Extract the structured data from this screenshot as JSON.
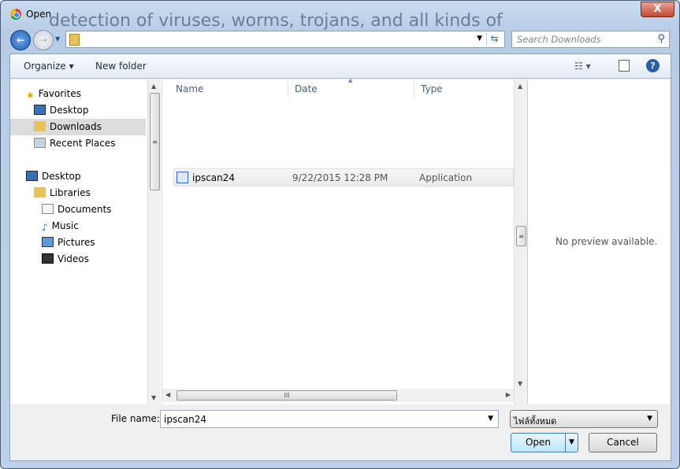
{
  "background": {
    "text": "detection of viruses, worms, trojans, and all kinds of"
  },
  "window": {
    "title": "Open",
    "close_label": "X"
  },
  "address": {
    "path": "",
    "search_placeholder": "Search Downloads"
  },
  "toolbar": {
    "organize": "Organize ▾",
    "new_folder": "New folder"
  },
  "nav": {
    "favorites": "Favorites",
    "favorites_items": [
      "Desktop",
      "Downloads",
      "Recent Places"
    ],
    "desktop": "Desktop",
    "libraries": "Libraries",
    "library_items": [
      "Documents",
      "Music",
      "Pictures",
      "Videos"
    ],
    "selected": "Downloads"
  },
  "list": {
    "columns": [
      "Name",
      "Date",
      "Type"
    ],
    "files": [
      {
        "name": "ipscan24",
        "date": "9/22/2015 12:28 PM",
        "type": "Application"
      }
    ]
  },
  "preview": {
    "text": "No preview available."
  },
  "footer": {
    "file_name_label": "File name:",
    "file_name_value": "ipscan24",
    "filter": "ไฟล์ทั้งหมด",
    "open": "Open",
    "cancel": "Cancel"
  }
}
